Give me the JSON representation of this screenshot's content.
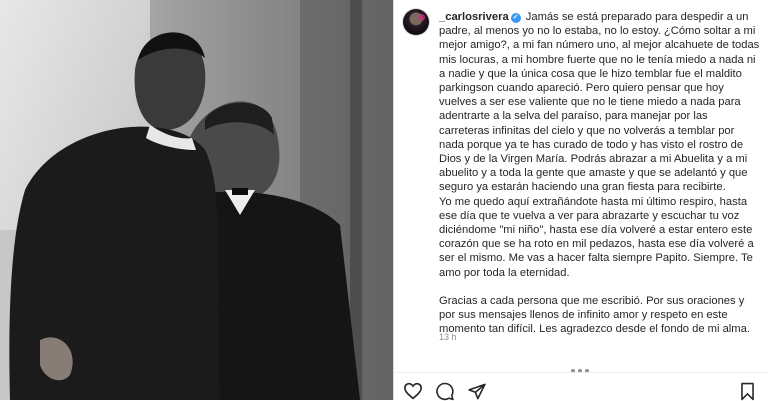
{
  "post": {
    "username": "_carlosrivera",
    "paragraph1": "Jamás se está preparado para despedir a un padre, al menos yo no lo estaba, no lo estoy. ¿Cómo soltar a mi mejor amigo?, a mi fan número uno, al mejor alcahuete de todas mis locuras, a mi hombre fuerte que no le tenía miedo a nada ni a nadie y que la única cosa que le hizo temblar fue el maldito parkingson cuando apareció. Pero quiero pensar que hoy vuelves a ser ese valiente que no le tiene miedo a nada para adentrarte a la selva del paraíso, para manejar por las carreteras infinitas del cielo y que no volverás a temblar por nada porque ya te has curado de todo y has visto el rostro de Dios y de la Virgen María. Podrás abrazar a mi Abuelita y a mi abuelito y a toda la gente que amaste y que se adelantó y que seguro ya estarán haciendo una gran fiesta para recibirte.",
    "paragraph2": "Yo me quedo aquí extrañándote hasta mi último respiro, hasta ese día que te vuelva a ver para abrazarte y escuchar tu voz diciéndome \"mi niño\", hasta ese día volveré a estar entero este corazón que se ha roto en mil pedazos, hasta ese día volveré a ser el mismo. Me vas a hacer falta siempre Papito. Siempre. Te amo por toda la eternidad.",
    "paragraph3": "Gracias a cada persona que me escribió. Por sus oraciones y por sus mensajes llenos de infinito amor y respeto en este momento tan difícil. Les agradezco desde el fondo de mi alma.",
    "timestamp": "13 h"
  },
  "icons": {
    "verified": "verified-badge-icon",
    "like": "heart-icon",
    "comment": "comment-icon",
    "share": "paper-plane-icon",
    "save": "bookmark-icon",
    "more": "more-dots-icon"
  },
  "colors": {
    "verified": "#3897f0",
    "text": "#262626",
    "muted": "#8e8e8e",
    "border": "#dbdbdb"
  }
}
